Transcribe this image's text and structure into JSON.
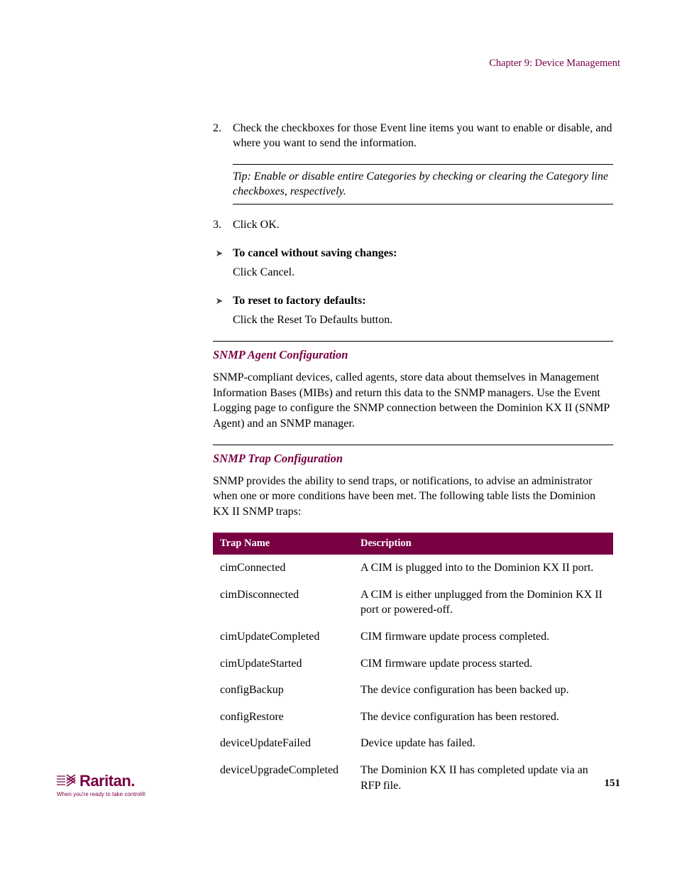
{
  "header": "Chapter 9: Device Management",
  "step2": "Check the checkboxes for those Event line items you want to enable or disable, and where you want to send the information.",
  "tip": "Tip: Enable or disable entire Categories by checking or clearing the Category line checkboxes, respectively.",
  "step3": "Click OK.",
  "arrow1_label": "To cancel without saving changes:",
  "arrow1_body": "Click Cancel.",
  "arrow2_label": "To reset to factory defaults:",
  "arrow2_body": "Click the Reset To Defaults button.",
  "agents_heading": "SNMP Agent Configuration",
  "agents_body": "SNMP-compliant devices, called agents, store data about themselves in Management Information Bases (MIBs) and return this data to the SNMP managers. Use the Event Logging page to configure the SNMP connection between the Dominion KX II (SNMP Agent) and an SNMP manager.",
  "traps_heading": "SNMP Trap Configuration",
  "traps_body": "SNMP provides the ability to send traps, or notifications, to advise an administrator when one or more conditions have been met. The following table lists the Dominion KX II SNMP traps:",
  "table": {
    "col1": "Trap Name",
    "col2": "Description",
    "rows": [
      {
        "name": "cimConnected",
        "desc": "A CIM is plugged into to the Dominion KX II port."
      },
      {
        "name": "cimDisconnected",
        "desc": "A CIM is either unplugged from the Dominion KX II port or powered-off."
      },
      {
        "name": "cimUpdateCompleted",
        "desc": "CIM firmware update process completed."
      },
      {
        "name": "cimUpdateStarted",
        "desc": "CIM firmware update process started."
      },
      {
        "name": "configBackup",
        "desc": "The device configuration has been backed up."
      },
      {
        "name": "configRestore",
        "desc": "The device configuration has been restored."
      },
      {
        "name": "deviceUpdateFailed",
        "desc": "Device update has failed."
      },
      {
        "name": "deviceUpgradeCompleted",
        "desc": "The Dominion KX II has completed update via an RFP file."
      }
    ]
  },
  "logo": {
    "text": "Raritan.",
    "tag": "When you're ready to take control®"
  },
  "page_number": "151"
}
